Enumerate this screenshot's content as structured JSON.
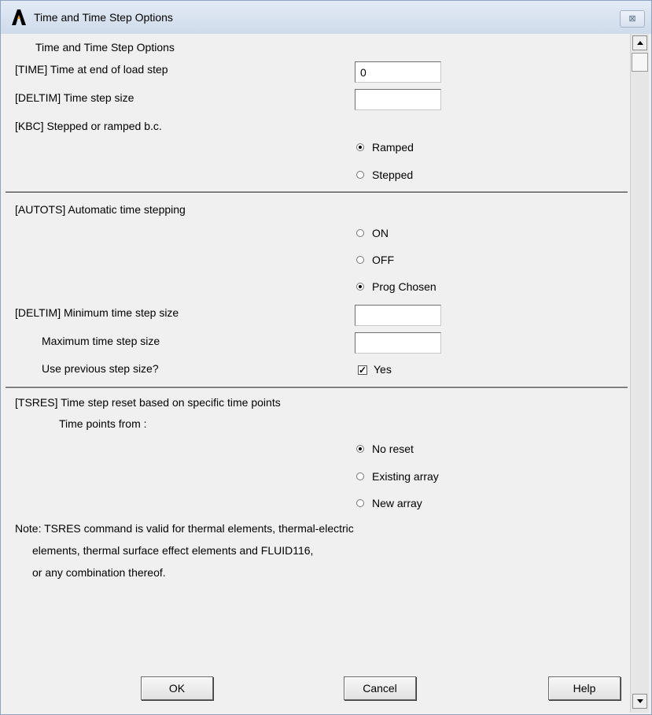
{
  "window": {
    "title": "Time and Time Step Options",
    "close_glyph": "⊠",
    "logo_icon": "ansys-logo-icon"
  },
  "section1": {
    "heading": "Time and Time Step Options",
    "time_label": "[TIME]  Time at end of load step",
    "time_value": "0",
    "deltim_label": "[DELTIM]  Time step size",
    "deltim_value": "",
    "kbc_label": "[KBC]     Stepped or ramped b.c.",
    "kbc_options": [
      {
        "label": "Ramped",
        "selected": true
      },
      {
        "label": "Stepped",
        "selected": false
      }
    ]
  },
  "section2": {
    "autots_label": "[AUTOTS] Automatic time stepping",
    "autots_options": [
      {
        "label": "ON",
        "selected": false
      },
      {
        "label": "OFF",
        "selected": false
      },
      {
        "label": "Prog Chosen",
        "selected": true
      }
    ],
    "min_label": "[DELTIM] Minimum time step size",
    "min_value": "",
    "max_label": "Maximum time step size",
    "max_value": "",
    "prev_label": "Use previous step size?",
    "prev_checked": true,
    "prev_check_label": "Yes"
  },
  "section3": {
    "tsres_label": "[TSRES]  Time step reset based on specific time points",
    "points_label": "Time points from :",
    "tsres_options": [
      {
        "label": "No reset",
        "selected": true
      },
      {
        "label": "Existing array",
        "selected": false
      },
      {
        "label": "New array",
        "selected": false
      }
    ],
    "note_line1": "Note: TSRES command is valid for thermal elements, thermal-electric",
    "note_line2": "elements, thermal surface effect elements and FLUID116,",
    "note_line3": "or any combination thereof."
  },
  "buttons": {
    "ok": "OK",
    "cancel": "Cancel",
    "help": "Help"
  }
}
